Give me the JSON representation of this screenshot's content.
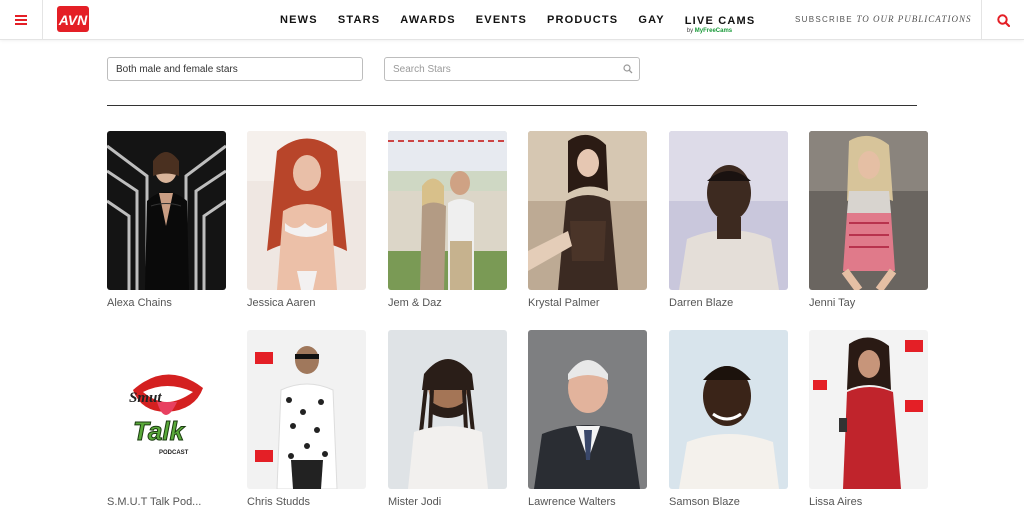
{
  "header": {
    "menu_icon": "hamburger-icon",
    "logo_text": "AVN",
    "nav": [
      "NEWS",
      "STARS",
      "AWARDS",
      "EVENTS",
      "PRODUCTS",
      "GAY",
      "LIVE CAMS"
    ],
    "live_cams_sub_prefix": "by",
    "live_cams_sub_brand": "MyFreeCams",
    "subscribe_prefix": "SUBSCRIBE",
    "subscribe_suffix": "TO OUR PUBLICATIONS",
    "search_icon": "search-icon",
    "accent_color": "#e41f26"
  },
  "filters": {
    "gender_value": "Both male and female stars",
    "search_placeholder": "Search Stars"
  },
  "stars": [
    {
      "name": "Alexa Chains"
    },
    {
      "name": "Jessica Aaren"
    },
    {
      "name": "Jem & Daz"
    },
    {
      "name": "Krystal Palmer"
    },
    {
      "name": "Darren Blaze"
    },
    {
      "name": "Jenni Tay"
    },
    {
      "name": "S.M.U.T Talk Pod..."
    },
    {
      "name": "Chris Studds"
    },
    {
      "name": "Mister Jodi"
    },
    {
      "name": "Lawrence Walters"
    },
    {
      "name": "Samson Blaze"
    },
    {
      "name": "Lissa Aires"
    }
  ],
  "smut_logo": {
    "line1": "Smut",
    "line2": "Talk",
    "line3": "PODCAST"
  }
}
